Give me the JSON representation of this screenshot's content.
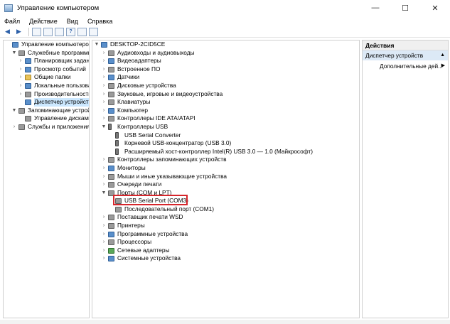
{
  "window": {
    "title": "Управление компьютером",
    "minimize": "—",
    "maximize": "☐",
    "close": "✕"
  },
  "menu": [
    "Файл",
    "Действие",
    "Вид",
    "Справка"
  ],
  "toolbar": {
    "back": "◀",
    "forward": "▶",
    "help": "?"
  },
  "left_tree": [
    {
      "label": "Управление компьютером (л",
      "exp": "",
      "icon": "c",
      "depth": 0
    },
    {
      "label": "Служебные программы",
      "exp": "▼",
      "icon": "g",
      "depth": 1
    },
    {
      "label": "Планировщик заданий",
      "exp": "›",
      "icon": "c",
      "depth": 2
    },
    {
      "label": "Просмотр событий",
      "exp": "›",
      "icon": "c",
      "depth": 2
    },
    {
      "label": "Общие папки",
      "exp": "›",
      "icon": "y",
      "depth": 2
    },
    {
      "label": "Локальные пользовате",
      "exp": "›",
      "icon": "c",
      "depth": 2
    },
    {
      "label": "Производительность",
      "exp": "›",
      "icon": "g",
      "depth": 2
    },
    {
      "label": "Диспетчер устройств",
      "exp": "",
      "icon": "c",
      "depth": 2,
      "selected": true
    },
    {
      "label": "Запоминающие устройст",
      "exp": "▼",
      "icon": "g",
      "depth": 1
    },
    {
      "label": "Управление дисками",
      "exp": "",
      "icon": "g",
      "depth": 2
    },
    {
      "label": "Службы и приложения",
      "exp": "›",
      "icon": "g",
      "depth": 1
    }
  ],
  "device_tree": [
    {
      "label": "DESKTOP-2CID5CE",
      "exp": "▼",
      "icon": "c",
      "depth": 0
    },
    {
      "label": "Аудиовходы и аудиовыходы",
      "exp": "›",
      "icon": "g",
      "depth": 1
    },
    {
      "label": "Видеоадаптеры",
      "exp": "›",
      "icon": "c",
      "depth": 1
    },
    {
      "label": "Встроенное ПО",
      "exp": "›",
      "icon": "g",
      "depth": 1
    },
    {
      "label": "Датчики",
      "exp": "›",
      "icon": "c",
      "depth": 1
    },
    {
      "label": "Дисковые устройства",
      "exp": "›",
      "icon": "g",
      "depth": 1
    },
    {
      "label": "Звуковые, игровые и видеоустройства",
      "exp": "›",
      "icon": "g",
      "depth": 1
    },
    {
      "label": "Клавиатуры",
      "exp": "›",
      "icon": "g",
      "depth": 1
    },
    {
      "label": "Компьютер",
      "exp": "›",
      "icon": "c",
      "depth": 1
    },
    {
      "label": "Контроллеры IDE ATA/ATAPI",
      "exp": "›",
      "icon": "g",
      "depth": 1
    },
    {
      "label": "Контроллеры USB",
      "exp": "▼",
      "icon": "usb",
      "depth": 1
    },
    {
      "label": "USB Serial Converter",
      "exp": "",
      "icon": "usb",
      "depth": 2
    },
    {
      "label": "Корневой USB-концентратор (USB 3.0)",
      "exp": "",
      "icon": "usb",
      "depth": 2
    },
    {
      "label": "Расширяемый хост-контроллер Intel(R) USB 3.0 — 1.0 (Майкрософт)",
      "exp": "",
      "icon": "usb",
      "depth": 2
    },
    {
      "label": "Контроллеры запоминающих устройств",
      "exp": "›",
      "icon": "g",
      "depth": 1
    },
    {
      "label": "Мониторы",
      "exp": "›",
      "icon": "c",
      "depth": 1
    },
    {
      "label": "Мыши и иные указывающие устройства",
      "exp": "›",
      "icon": "g",
      "depth": 1
    },
    {
      "label": "Очереди печати",
      "exp": "›",
      "icon": "g",
      "depth": 1
    },
    {
      "label": "Порты (COM и LPT)",
      "exp": "▼",
      "icon": "g",
      "depth": 1
    },
    {
      "label": "USB Serial Port (COM3)",
      "exp": "",
      "icon": "g",
      "depth": 2
    },
    {
      "label": "Последовательный порт (COM1)",
      "exp": "",
      "icon": "g",
      "depth": 2
    },
    {
      "label": "Поставщик печати WSD",
      "exp": "›",
      "icon": "g",
      "depth": 1
    },
    {
      "label": "Принтеры",
      "exp": "›",
      "icon": "g",
      "depth": 1
    },
    {
      "label": "Программные устройства",
      "exp": "›",
      "icon": "c",
      "depth": 1
    },
    {
      "label": "Процессоры",
      "exp": "›",
      "icon": "g",
      "depth": 1
    },
    {
      "label": "Сетевые адаптеры",
      "exp": "›",
      "icon": "gr",
      "depth": 1
    },
    {
      "label": "Системные устройства",
      "exp": "›",
      "icon": "c",
      "depth": 1
    }
  ],
  "actions": {
    "header": "Действия",
    "section": "Диспетчер устройств",
    "section_arrow": "▲",
    "item": "Дополнительные дей...",
    "item_arrow": "▶"
  },
  "highlight_color": "#d6252b",
  "selection_color": "#cce8ff"
}
